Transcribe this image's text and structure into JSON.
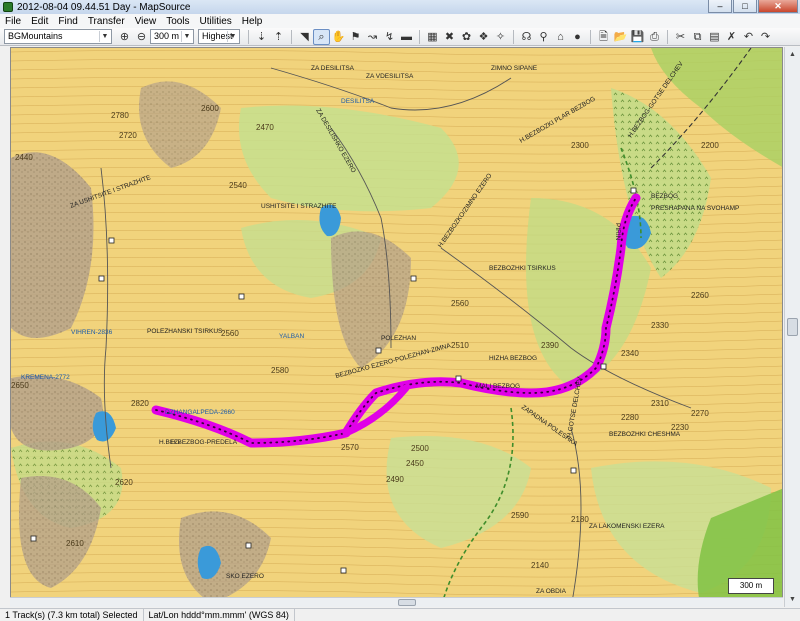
{
  "window": {
    "title": "2012-08-04 09.44.51 Day - MapSource"
  },
  "menu": [
    "File",
    "Edit",
    "Find",
    "Transfer",
    "View",
    "Tools",
    "Utilities",
    "Help"
  ],
  "toolbar": {
    "map_product": "BGMountains",
    "zoom_level": "300 m",
    "detail_level": "Highest"
  },
  "map": {
    "scale_label": "300 m",
    "peak_labels": [
      {
        "text": "2780"
      },
      {
        "text": "2720"
      },
      {
        "text": "2650"
      },
      {
        "text": "2540"
      },
      {
        "text": "2620"
      },
      {
        "text": "2610"
      },
      {
        "text": "2820"
      },
      {
        "text": "2600"
      },
      {
        "text": "2560"
      },
      {
        "text": "2580"
      },
      {
        "text": "2470"
      },
      {
        "text": "2440"
      },
      {
        "text": "2590"
      },
      {
        "text": "2570"
      },
      {
        "text": "2450"
      },
      {
        "text": "2560"
      },
      {
        "text": "2490"
      },
      {
        "text": "2510"
      },
      {
        "text": "2500"
      },
      {
        "text": "2390"
      },
      {
        "text": "2330"
      },
      {
        "text": "2340"
      },
      {
        "text": "2260"
      },
      {
        "text": "2310"
      },
      {
        "text": "2280"
      },
      {
        "text": "2270"
      },
      {
        "text": "2230"
      },
      {
        "text": "2180"
      },
      {
        "text": "2200"
      },
      {
        "text": "2140"
      },
      {
        "text": "2300"
      }
    ],
    "place_labels": [
      {
        "text": "ZA DESILITSA"
      },
      {
        "text": "ZA VDESILITSA"
      },
      {
        "text": "DESILITSA"
      },
      {
        "text": "ZA DESILISHKO EZERO"
      },
      {
        "text": "ZA USHITSITE I STRAZHITE"
      },
      {
        "text": "USHITSITE I STRAZHITE"
      },
      {
        "text": "ZIMNO SIPANE"
      },
      {
        "text": "H.BEZBOZKI PLAR BEZBOG"
      },
      {
        "text": "H.BEZBOZKO/ZIMNO EZERO"
      },
      {
        "text": "BEZBOZHKI TSIRKUS"
      },
      {
        "text": "POLEZHANSKI TSIRKUS"
      },
      {
        "text": "POLEZHAN"
      },
      {
        "text": "BEZBOZKO EZERO-POLEZHAN-ZIMNA"
      },
      {
        "text": "MALI BEZBOG"
      },
      {
        "text": "HIZHA BEZBOG"
      },
      {
        "text": "H.BEZBOG-PREDELA"
      },
      {
        "text": "BEZBOG"
      },
      {
        "text": "PRESHAPANA NA SVOHAMP"
      },
      {
        "text": "PIRIN"
      },
      {
        "text": "BEZBOZHKI CHESHMA"
      },
      {
        "text": "H.BEZBOG-GOTSE DELCHEV"
      },
      {
        "text": "ZAPADNA POLESHKA"
      },
      {
        "text": "H.GOTSE DELCHEV"
      },
      {
        "text": "ZA OBDIA"
      },
      {
        "text": "ZA LAKOMENSKI EZERA"
      },
      {
        "text": "VIHREN-2836"
      },
      {
        "text": "KREMENA-2772"
      },
      {
        "text": "DZHANGALPEDA-2660"
      },
      {
        "text": "YALBAN"
      },
      {
        "text": "SKO EZERO"
      },
      {
        "text": "H.BEZ-"
      }
    ]
  },
  "status": {
    "selection": "1 Track(s) (7.3 km total) Selected",
    "coord_format": "Lat/Lon hddd°mm.mmm' (WGS 84)"
  }
}
